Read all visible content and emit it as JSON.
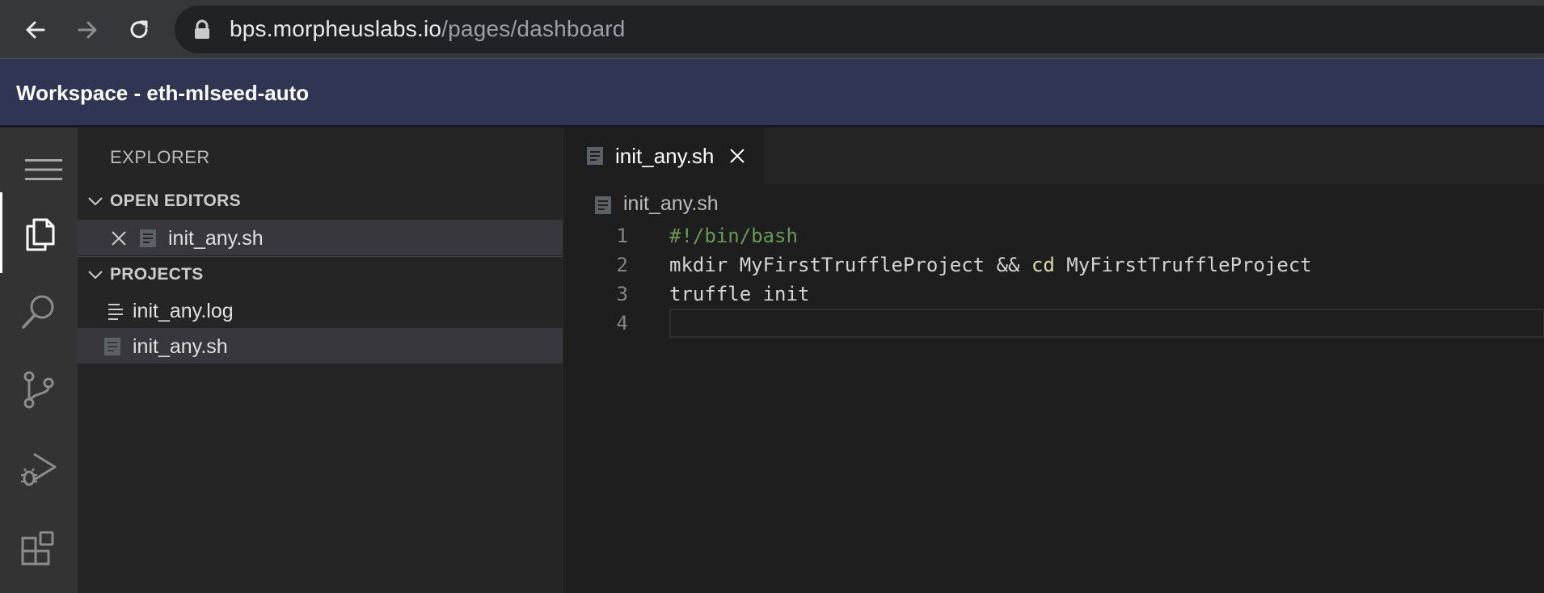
{
  "browser": {
    "url_host": "bps.morpheuslabs.io",
    "url_path": "/pages/dashboard"
  },
  "app": {
    "title": "Workspace - eth-mlseed-auto"
  },
  "sidebar": {
    "title": "EXPLORER",
    "open_editors": {
      "label": "OPEN EDITORS",
      "items": [
        {
          "name": "init_any.sh",
          "icon": "shell-file-icon"
        }
      ]
    },
    "projects": {
      "label": "PROJECTS",
      "items": [
        {
          "name": "init_any.log",
          "icon": "text-file-icon"
        },
        {
          "name": "init_any.sh",
          "icon": "shell-file-icon"
        }
      ]
    }
  },
  "editor": {
    "tab": {
      "label": "init_any.sh"
    },
    "breadcrumb": "init_any.sh",
    "lines": [
      {
        "num": "1",
        "parts": [
          {
            "text": "#!/bin/bash",
            "type": "comment"
          }
        ]
      },
      {
        "num": "2",
        "parts": [
          {
            "text": "mkdir MyFirstTruffleProject && ",
            "type": "plain"
          },
          {
            "text": "cd",
            "type": "builtin"
          },
          {
            "text": " MyFirstTruffleProject",
            "type": "plain"
          }
        ]
      },
      {
        "num": "3",
        "parts": [
          {
            "text": "truffle init",
            "type": "plain"
          }
        ]
      },
      {
        "num": "4",
        "parts": [
          {
            "text": "",
            "type": "plain"
          }
        ]
      }
    ]
  },
  "colors": {
    "browser_bar": "#35383b",
    "header": "#2f3552",
    "activity_bar": "#333333",
    "sidebar": "#252526",
    "editor": "#1e1e1e",
    "comment": "#6a9955",
    "builtin": "#dcdcaa"
  }
}
